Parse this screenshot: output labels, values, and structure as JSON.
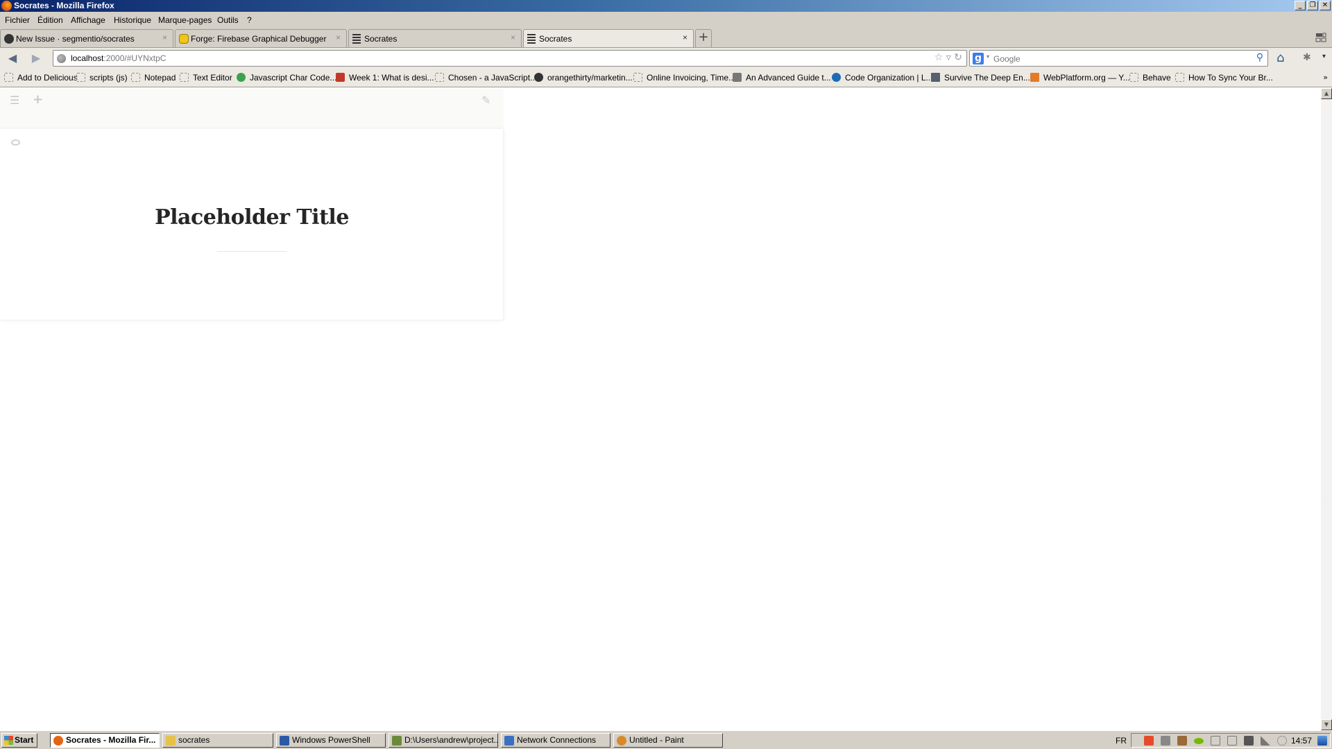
{
  "window": {
    "title": "Socrates - Mozilla Firefox",
    "controls": {
      "minimize": "_",
      "restore": "❐",
      "close": "✕"
    }
  },
  "menubar": {
    "items": [
      {
        "label": "Fichier"
      },
      {
        "label": "Édition"
      },
      {
        "label": "Affichage"
      },
      {
        "label": "Historique"
      },
      {
        "label": "Marque-pages"
      },
      {
        "label": "Outils"
      },
      {
        "label": "?"
      }
    ]
  },
  "tabs": [
    {
      "label": "New Issue · segmentio/socrates",
      "icon": "github-icon",
      "close": "×",
      "active": false
    },
    {
      "label": "Forge: Firebase Graphical Debugger",
      "icon": "firebase-icon",
      "close": "×",
      "active": false
    },
    {
      "label": "Socrates",
      "icon": "document-lines-icon",
      "close": "×",
      "active": false
    },
    {
      "label": "Socrates",
      "icon": "document-lines-icon",
      "close": "×",
      "active": true
    }
  ],
  "new_tab_label": "+",
  "navbar": {
    "back": "◀",
    "forward": "▶",
    "url_host": "localhost",
    "url_rest": ":2000/#UYNxtpC",
    "url_icons": "☆ ▿ ↻",
    "search_engine_letter": "g",
    "search_dropdown": "▾",
    "search_placeholder": "Google",
    "search_icon": "⚲",
    "home_icon": "⌂",
    "addon_icon": "✱",
    "menu_dropdown": "▾"
  },
  "bookmarks": [
    {
      "label": "Add to Delicious",
      "icon": "dashed"
    },
    {
      "label": "scripts (js)",
      "icon": "dashed"
    },
    {
      "label": "Notepad",
      "icon": "dashed"
    },
    {
      "label": "Text Editor",
      "icon": "dashed"
    },
    {
      "label": "Javascript Char Code...",
      "icon": "#3aa34a"
    },
    {
      "label": "Week 1: What is desi...",
      "icon": "#c0392b"
    },
    {
      "label": "Chosen - a JavaScript...",
      "icon": "dashed"
    },
    {
      "label": "orangethirty/marketin...",
      "icon": "#333333"
    },
    {
      "label": "Online Invoicing, Time...",
      "icon": "dashed"
    },
    {
      "label": "An Advanced Guide t...",
      "icon": "#777777"
    },
    {
      "label": "Code Organization | L...",
      "icon": "#1c6db5"
    },
    {
      "label": "Survive The Deep En...",
      "icon": "#556070"
    },
    {
      "label": "WebPlatform.org — Y...",
      "icon": "#e27c2b"
    },
    {
      "label": "Behave",
      "icon": "dashed"
    },
    {
      "label": "How To Sync Your Br...",
      "icon": "dashed"
    }
  ],
  "bookmarks_more": "»",
  "editor": {
    "toolbar": {
      "menu_icon": "☰",
      "add_icon": "+",
      "edit_icon": "✎"
    },
    "title": "Placeholder Title"
  },
  "taskbar": {
    "start_label": "Start",
    "tasks": [
      {
        "label": "Socrates - Mozilla Fir...",
        "active": true,
        "icon": "#e56413"
      },
      {
        "label": "socrates",
        "active": false,
        "icon": "#e8c14a"
      },
      {
        "label": "Windows PowerShell",
        "active": false,
        "icon": "#2b5ba7"
      },
      {
        "label": "D:\\Users\\andrew\\project...",
        "active": false,
        "icon": "#6a8a3a"
      },
      {
        "label": "Network Connections",
        "active": false,
        "icon": "#3b6fc4"
      },
      {
        "label": "Untitled - Paint",
        "active": false,
        "icon": "#d88a2a"
      }
    ],
    "language": "FR",
    "tray_icons": [
      "#e54b2a",
      "#888888",
      "#9a6a3a",
      "#76b900",
      "#cccccc",
      "#aaaaaa",
      "#555555",
      "#777777",
      "#999999"
    ],
    "clock": "14:57"
  }
}
